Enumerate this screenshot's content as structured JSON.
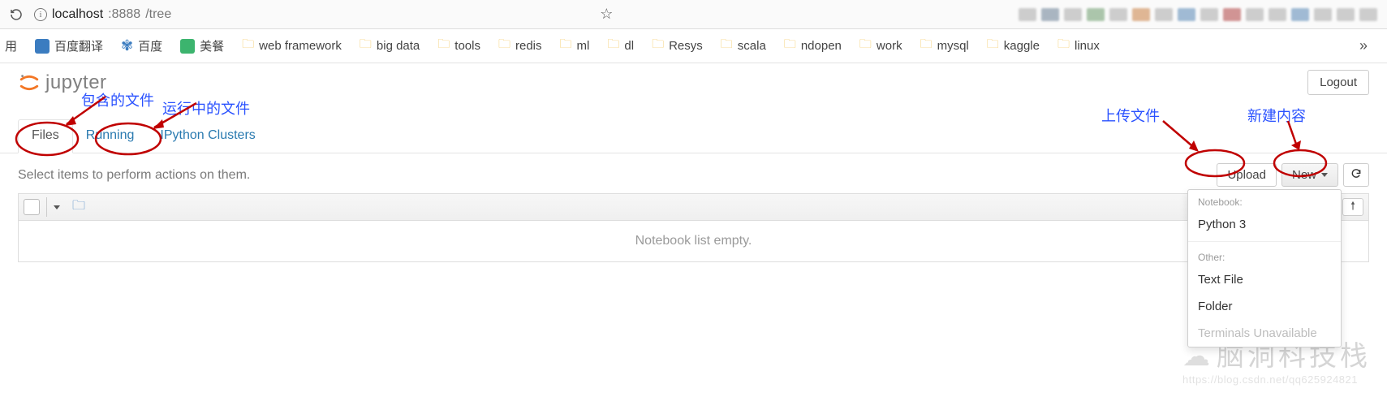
{
  "browser": {
    "url_host": "localhost",
    "url_port": ":8888",
    "url_path": "/tree"
  },
  "bookmarks": {
    "cut_label": "用",
    "items": [
      {
        "label": "百度翻译",
        "color": "#3b7cc0",
        "kind": "sq"
      },
      {
        "label": "百度",
        "color": "#3b7cc0",
        "kind": "paw"
      },
      {
        "label": "美餐",
        "color": "#3cb46e",
        "kind": "sq"
      },
      {
        "label": "web framework",
        "kind": "folder"
      },
      {
        "label": "big data",
        "kind": "folder"
      },
      {
        "label": "tools",
        "kind": "folder"
      },
      {
        "label": "redis",
        "kind": "folder"
      },
      {
        "label": "ml",
        "kind": "folder"
      },
      {
        "label": "dl",
        "kind": "folder"
      },
      {
        "label": "Resys",
        "kind": "folder"
      },
      {
        "label": "scala",
        "kind": "folder"
      },
      {
        "label": "ndopen",
        "kind": "folder"
      },
      {
        "label": "work",
        "kind": "folder"
      },
      {
        "label": "mysql",
        "kind": "folder"
      },
      {
        "label": "kaggle",
        "kind": "folder"
      },
      {
        "label": "linux",
        "kind": "folder"
      }
    ]
  },
  "jupyter": {
    "logo_text": "jupyter",
    "logout": "Logout",
    "tabs": {
      "files": "Files",
      "running": "Running",
      "clusters": "IPython Clusters"
    },
    "hint": "Select items to perform actions on them.",
    "upload": "Upload",
    "new": "New",
    "list_empty": "Notebook list empty."
  },
  "new_menu": {
    "section_notebook": "Notebook:",
    "python3": "Python 3",
    "section_other": "Other:",
    "textfile": "Text File",
    "folder": "Folder",
    "terminals": "Terminals Unavailable"
  },
  "annotations": {
    "files_note": "包含的文件",
    "running_note": "运行中的文件",
    "upload_note": "上传文件",
    "new_note": "新建内容"
  },
  "watermark": {
    "cn": "脑洞科技栈",
    "url": "https://blog.csdn.net/qq625924821"
  }
}
